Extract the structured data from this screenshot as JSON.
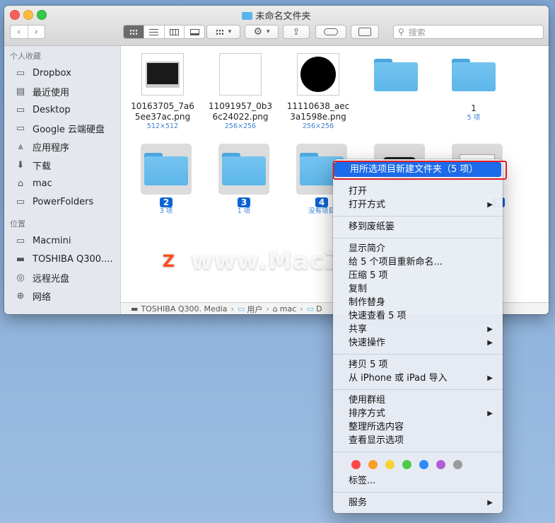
{
  "window": {
    "title": "未命名文件夹",
    "search_placeholder": "搜索"
  },
  "sidebar": {
    "favorites_header": "个人收藏",
    "favorites": [
      {
        "label": "Dropbox",
        "icon": "folder-icon"
      },
      {
        "label": "最近使用",
        "icon": "recent-icon"
      },
      {
        "label": "Desktop",
        "icon": "folder-icon"
      },
      {
        "label": "Google 云端硬盘",
        "icon": "folder-icon"
      },
      {
        "label": "应用程序",
        "icon": "applications-icon"
      },
      {
        "label": "下载",
        "icon": "download-icon"
      },
      {
        "label": "mac",
        "icon": "home-icon"
      },
      {
        "label": "PowerFolders",
        "icon": "folder-icon"
      }
    ],
    "locations_header": "位置",
    "locations": [
      {
        "label": "Macmini",
        "icon": "computer-icon"
      },
      {
        "label": "TOSHIBA Q300....",
        "icon": "drive-icon"
      },
      {
        "label": "远程光盘",
        "icon": "disc-icon"
      },
      {
        "label": "网络",
        "icon": "network-icon"
      }
    ],
    "tags_header": "标签"
  },
  "files": [
    {
      "name": "10163705_7a65ee37ac.png",
      "meta": "512×512",
      "kind": "imac-image"
    },
    {
      "name": "11091957_0b36c24022.png",
      "meta": "256×256",
      "kind": "apple-image"
    },
    {
      "name": "11110638_aec3a1598e.png",
      "meta": "256×256",
      "kind": "apple-circle-image"
    },
    {
      "name": "",
      "meta": "",
      "kind": "folder"
    },
    {
      "name": "1",
      "meta": "5 项",
      "kind": "folder"
    }
  ],
  "selected_items": [
    {
      "badge": "2",
      "meta": "3 项"
    },
    {
      "badge": "3",
      "meta": "1 项"
    },
    {
      "badge": "4",
      "meta": "没有项目"
    }
  ],
  "partial_badge": "d",
  "pathbar": [
    "TOSHIBA Q300. Media",
    "用户",
    "mac",
    "D"
  ],
  "context_menu": {
    "highlighted": "用所选项目新建文件夹（5 项）",
    "group1": [
      "打开",
      "打开方式"
    ],
    "group2": [
      "移到废纸篓"
    ],
    "group3": [
      "显示简介",
      "给 5 个项目重新命名...",
      "压缩 5 项",
      "复制",
      "制作替身",
      "快速查看 5 项",
      "共享",
      "快速操作"
    ],
    "group4": [
      "拷贝 5 项",
      "从 iPhone 或 iPad 导入"
    ],
    "group5": [
      "使用群组",
      "排序方式",
      "整理所选内容",
      "查看显示选项"
    ],
    "tags_label": "标签...",
    "services": "服务"
  },
  "tag_colors": [
    "#fc4a4a",
    "#fa9d2a",
    "#f8d232",
    "#4ecb46",
    "#2c8bf6",
    "#b25cd8",
    "#9b9b9b"
  ],
  "watermark": "www.MacZ.com",
  "watermark_logo": "Z"
}
